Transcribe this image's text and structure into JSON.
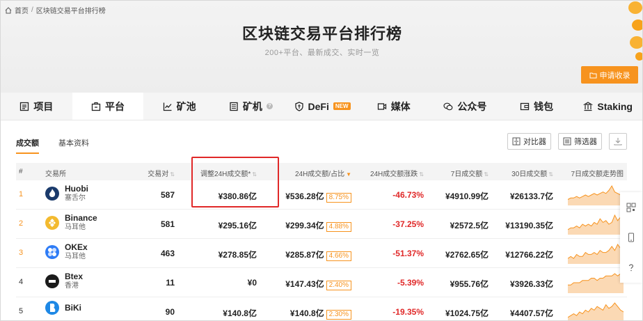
{
  "breadcrumb": {
    "home": "首页",
    "sep": "/",
    "current": "区块链交易平台排行榜"
  },
  "header": {
    "title": "区块链交易平台排行榜",
    "subtitle": "200+平台、最新成交、实时一览",
    "apply_label": "申请收录"
  },
  "tabs": [
    {
      "label": "项目",
      "icon": "list-icon"
    },
    {
      "label": "平台",
      "icon": "platform-icon"
    },
    {
      "label": "矿池",
      "icon": "chart-line-icon"
    },
    {
      "label": "矿机",
      "icon": "server-icon"
    },
    {
      "label": "DeFi",
      "icon": "shield-icon",
      "badge": "NEW"
    },
    {
      "label": "媒体",
      "icon": "video-icon"
    },
    {
      "label": "公众号",
      "icon": "wechat-icon"
    },
    {
      "label": "钱包",
      "icon": "wallet-icon"
    },
    {
      "label": "Staking",
      "icon": "staking-icon"
    }
  ],
  "subtabs": {
    "volume": "成交额",
    "basic": "基本资料"
  },
  "tools": {
    "compare": "对比器",
    "filter": "筛选器"
  },
  "columns": {
    "rank": "#",
    "name": "交易所",
    "pairs": "交易对",
    "adj_volume": "调整24H成交额*",
    "volume_share": "24H成交额/占比",
    "change": "24H成交额涨跌",
    "vol_7d": "7日成交额",
    "vol_30d": "30日成交额",
    "trend": "7日成交额走势图"
  },
  "rows": [
    {
      "rank": "1",
      "name": "Huobi",
      "location": "塞舌尔",
      "pairs": "587",
      "adj": "¥380.86亿",
      "vol": "¥536.28亿",
      "share": "8.75%",
      "change": "-46.73%",
      "v7": "¥4910.99亿",
      "v30": "¥26133.7亿",
      "logo_color": "#1a3a6b",
      "logo_icon": "flame-icon",
      "trend": [
        3,
        4,
        4,
        5,
        4,
        5,
        6,
        5,
        6,
        7,
        6,
        7,
        8,
        7,
        9,
        12,
        8,
        7,
        6,
        6
      ]
    },
    {
      "rank": "2",
      "name": "Binance",
      "location": "马耳他",
      "pairs": "581",
      "adj": "¥295.16亿",
      "vol": "¥299.34亿",
      "share": "4.88%",
      "change": "-37.25%",
      "v7": "¥2572.5亿",
      "v30": "¥13190.35亿",
      "logo_color": "#f3ba2f",
      "logo_icon": "binance-icon",
      "trend": [
        2,
        3,
        3,
        4,
        3,
        5,
        4,
        5,
        4,
        6,
        5,
        8,
        6,
        7,
        5,
        6,
        10,
        7,
        9,
        6
      ]
    },
    {
      "rank": "3",
      "name": "OKEx",
      "location": "马耳他",
      "pairs": "463",
      "adj": "¥278.85亿",
      "vol": "¥285.87亿",
      "share": "4.66%",
      "change": "-51.37%",
      "v7": "¥2762.65亿",
      "v30": "¥12766.22亿",
      "logo_color": "#2e7cf6",
      "logo_icon": "okex-icon",
      "trend": [
        2,
        3,
        2,
        4,
        3,
        3,
        5,
        4,
        4,
        5,
        4,
        6,
        5,
        5,
        6,
        8,
        6,
        9,
        7,
        6
      ]
    },
    {
      "rank": "4",
      "name": "Btex",
      "location": "香港",
      "pairs": "11",
      "adj": "¥0",
      "vol": "¥147.43亿",
      "share": "2.40%",
      "change": "-5.39%",
      "v7": "¥955.76亿",
      "v30": "¥3926.33亿",
      "logo_color": "#1b1b1b",
      "logo_icon": "btex-icon",
      "trend": [
        3,
        3,
        4,
        4,
        4,
        5,
        5,
        5,
        6,
        6,
        5,
        6,
        6,
        7,
        7,
        7,
        8,
        7,
        8,
        8
      ]
    },
    {
      "rank": "5",
      "name": "BiKi",
      "location": "",
      "pairs": "90",
      "adj": "¥140.8亿",
      "vol": "¥140.8亿",
      "share": "2.30%",
      "change": "-19.35%",
      "v7": "¥1024.75亿",
      "v30": "¥4407.57亿",
      "logo_color": "#1e88e5",
      "logo_icon": "biki-icon",
      "trend": [
        2,
        3,
        4,
        3,
        5,
        4,
        6,
        5,
        7,
        6,
        8,
        7,
        6,
        9,
        7,
        8,
        10,
        8,
        6,
        5
      ]
    }
  ],
  "colors": {
    "accent": "#f7931e",
    "negative": "#e02828",
    "highlight": "#e02828"
  }
}
